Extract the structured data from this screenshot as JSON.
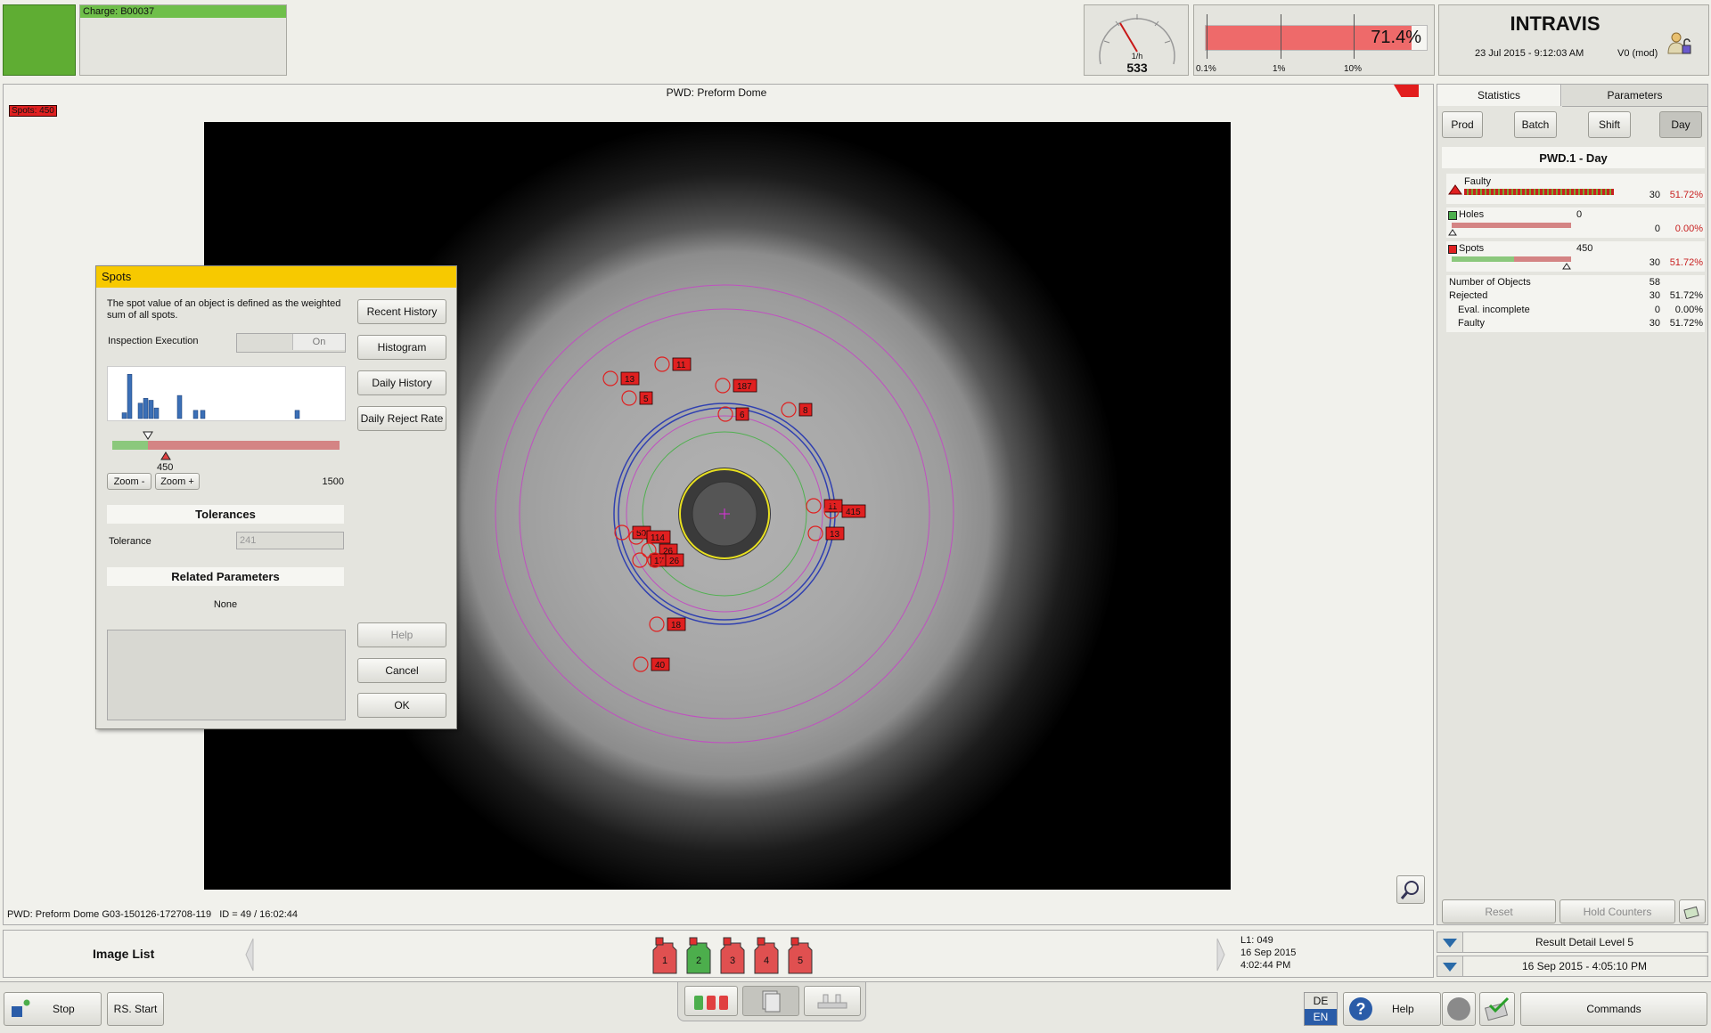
{
  "header": {
    "charge_label": "Charge: B00037",
    "status_color": "#5fad33",
    "speed_unit": "1/h",
    "speed_value": "533",
    "reject_percent": "71.4%",
    "reject_fill": 0.93,
    "reject_scale": [
      "0.1%",
      "1%",
      "10%"
    ],
    "brand": "INTRAVIS",
    "datetime": "23 Jul 2015 - 9:12:03 AM",
    "version": "V0 (mod)"
  },
  "viewer": {
    "title": "PWD: Preform Dome",
    "spots_badge": "Spots: 450",
    "footer_info": "PWD: Preform Dome G03-150126-172708-119   ID = 49 / 16:02:44",
    "spot_markers": [
      "11",
      "13",
      "5",
      "187",
      "8",
      "6",
      "11",
      "415",
      "13",
      "50",
      "114",
      "26",
      "17",
      "26",
      "18",
      "40"
    ]
  },
  "dialog": {
    "title": "Spots",
    "description": "The spot value of an object is defined as the weighted sum of all spots.",
    "inspection_label": "Inspection Execution",
    "inspection_state": "On",
    "buttons": {
      "recent_history": "Recent History",
      "histogram": "Histogram",
      "daily_history": "Daily History",
      "daily_reject_rate": "Daily Reject Rate",
      "help": "Help",
      "cancel": "Cancel",
      "ok": "OK"
    },
    "histogram_bars": [
      0.12,
      0.92,
      0.32,
      0.42,
      0.38,
      0.22,
      0.48,
      0.17,
      0.17,
      0.17
    ],
    "threshold_value": "450",
    "scale_max": "1500",
    "zoom_minus": "Zoom -",
    "zoom_plus": "Zoom +",
    "tolerances_heading": "Tolerances",
    "tolerance_label": "Tolerance",
    "tolerance_value": "241",
    "related_heading": "Related Parameters",
    "related_value": "None"
  },
  "right_panel": {
    "tabs": [
      "Statistics",
      "Parameters"
    ],
    "periods": [
      "Prod",
      "Batch",
      "Shift",
      "Day"
    ],
    "active_period": "Day",
    "section_title": "PWD.1 - Day",
    "faulty": {
      "label": "Faulty",
      "count": "30",
      "percent": "51.72%"
    },
    "holes": {
      "label": "Holes",
      "limit": "0",
      "count": "0",
      "percent": "0.00%"
    },
    "spots": {
      "label": "Spots",
      "limit": "450",
      "count": "30",
      "percent": "51.72%"
    },
    "stats": [
      {
        "label": "Number of Objects",
        "count": "58",
        "percent": ""
      },
      {
        "label": "Rejected",
        "count": "30",
        "percent": "51.72%"
      },
      {
        "label": "Eval. incomplete",
        "count": "0",
        "percent": "0.00%"
      },
      {
        "label": "Faulty",
        "count": "30",
        "percent": "51.72%"
      }
    ],
    "reset_label": "Reset",
    "hold_label": "Hold Counters",
    "result_detail": "Result Detail Level 5",
    "result_datetime": "16 Sep 2015 - 4:05:10 PM"
  },
  "image_list": {
    "label": "Image List",
    "items": [
      {
        "num": "1",
        "color": "#e05050"
      },
      {
        "num": "2",
        "color": "#4cae4c"
      },
      {
        "num": "3",
        "color": "#e05050"
      },
      {
        "num": "4",
        "color": "#e05050"
      },
      {
        "num": "5",
        "color": "#e05050"
      }
    ],
    "line_info": "L1: 049",
    "date": "16 Sep 2015",
    "time": "4:02:44 PM"
  },
  "bottom_bar": {
    "stop": "Stop",
    "rs_start": "RS. Start",
    "lang_de": "DE",
    "lang_en": "EN",
    "help": "Help",
    "commands": "Commands"
  }
}
